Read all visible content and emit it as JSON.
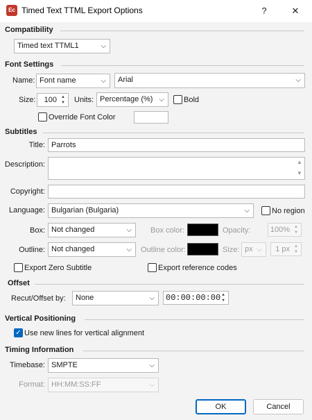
{
  "window": {
    "app_icon_text": "Ec",
    "title": "Timed Text TTML Export Options",
    "help_label": "?",
    "close_label": "✕"
  },
  "compatibility": {
    "section": "Compatibility",
    "format_value": "Timed text TTML1"
  },
  "font_settings": {
    "section": "Font Settings",
    "name_label": "Name:",
    "name_type_value": "Font name",
    "font_value": "Arial",
    "size_label": "Size:",
    "size_value": "100",
    "units_label": "Units:",
    "units_value": "Percentage (%)",
    "bold_label": "Bold",
    "bold_checked": false,
    "override_label": "Override Font Color",
    "override_checked": false
  },
  "subtitles": {
    "section": "Subtitles",
    "title_label": "Title:",
    "title_value": "Parrots",
    "description_label": "Description:",
    "description_value": "",
    "copyright_label": "Copyright:",
    "copyright_value": "",
    "language_label": "Language:",
    "language_value": "Bulgarian (Bulgaria)",
    "no_region_label": "No region",
    "no_region_checked": false,
    "box_label": "Box:",
    "box_value": "Not changed",
    "box_color_label": "Box color:",
    "box_color": "#000000",
    "opacity_label": "Opacity:",
    "opacity_value": "100%",
    "outline_label": "Outline:",
    "outline_value": "Not changed",
    "outline_color_label": "Outline color:",
    "outline_color": "#000000",
    "outline_size_label": "Size:",
    "outline_unit_value": "px",
    "outline_size_value": "1 px",
    "export_zero_label": "Export Zero Subtitle",
    "export_zero_checked": false,
    "export_ref_label": "Export reference codes",
    "export_ref_checked": false
  },
  "offset": {
    "section": "Offset",
    "recut_label": "Recut/Offset by:",
    "recut_value": "None",
    "timecode_value": "00:00:00:00"
  },
  "vertical": {
    "section": "Vertical Positioning",
    "newlines_label": "Use new lines for vertical alignment",
    "newlines_checked": true
  },
  "timing": {
    "section": "Timing Information",
    "timebase_label": "Timebase:",
    "timebase_value": "SMPTE",
    "format_label": "Format:",
    "format_value": "HH:MM:SS:FF"
  },
  "buttons": {
    "ok": "OK",
    "cancel": "Cancel"
  },
  "icons": {
    "chevron": "⌵",
    "check": "✓",
    "up": "▲",
    "down": "▼"
  },
  "colors": {
    "accent": "#0067c0",
    "app_icon": "#c0392b"
  }
}
